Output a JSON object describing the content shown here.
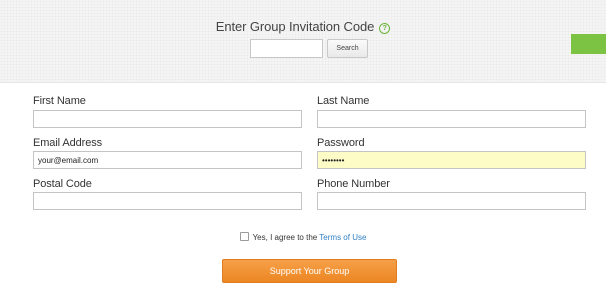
{
  "invitation": {
    "title": "Enter Group Invitation Code",
    "help_icon": "question-mark-circle-icon",
    "code_value": "",
    "search_label": "Search"
  },
  "form": {
    "first_name": {
      "label": "First Name",
      "value": ""
    },
    "last_name": {
      "label": "Last Name",
      "value": ""
    },
    "email": {
      "label": "Email Address",
      "value": "your@email.com"
    },
    "password": {
      "label": "Password",
      "value": "••••••••"
    },
    "postal_code": {
      "label": "Postal Code",
      "value": ""
    },
    "phone_number": {
      "label": "Phone Number",
      "value": ""
    }
  },
  "agreement": {
    "prefix": "Yes, I agree to the ",
    "link_text": "Terms of Use",
    "checked": false
  },
  "submit_label": "Support Your Group",
  "colors": {
    "accent_green": "#7cc243",
    "button_orange": "#ef8a2a",
    "link_blue": "#2f7fc4",
    "password_highlight": "#fdfcc6"
  }
}
